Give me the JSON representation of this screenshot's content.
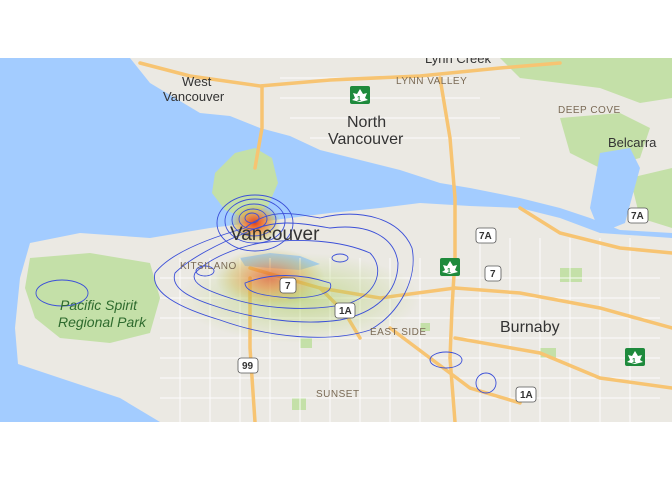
{
  "map": {
    "labels": {
      "lynn_creek": "Lynn Creek",
      "west_vancouver_1": "West",
      "west_vancouver_2": "Vancouver",
      "lynn_valley": "LYNN VALLEY",
      "north_vancouver_1": "North",
      "north_vancouver_2": "Vancouver",
      "deep_cove": "DEEP COVE",
      "belcarra": "Belcarra",
      "vancouver": "Vancouver",
      "kitsilano": "KITSILANO",
      "pacific_spirit_1": "Pacific Spirit",
      "pacific_spirit_2": "Regional Park",
      "east_side": "EAST SIDE",
      "burnaby": "Burnaby",
      "sunset": "SUNSET"
    },
    "highway_shields": {
      "h1_north": "1",
      "h1_east_van": "1",
      "h1_burnaby": "1",
      "h7a_center": "7A",
      "h7a_east": "7A",
      "h7_center": "7",
      "h7_heat": "7",
      "h1a_center": "1A",
      "h1a_south": "1A",
      "h99": "99"
    },
    "colors": {
      "water": "#a3ccff",
      "land": "#ebe9e3",
      "park": "#c4e0a8",
      "highway": "#f7c472",
      "contour": "#3b4fd8",
      "heat_core": "#e8411c"
    }
  }
}
